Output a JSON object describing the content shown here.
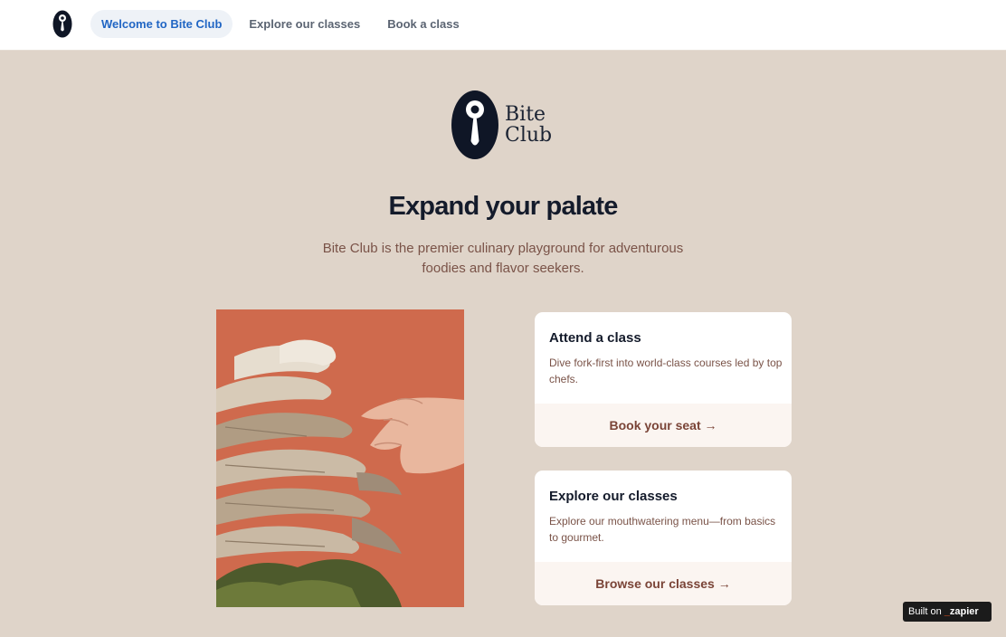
{
  "nav": {
    "logo_icon": "bite-club-spoon-icon",
    "links": [
      {
        "label": "Welcome to Bite Club",
        "active": true
      },
      {
        "label": "Explore our classes",
        "active": false
      },
      {
        "label": "Book a class",
        "active": false
      }
    ]
  },
  "hero": {
    "logo_line1": "Bite",
    "logo_line2": "Club",
    "headline": "Expand your palate",
    "subtitle": "Bite Club is the premier culinary playground for adventurous foodies and flavor seekers."
  },
  "cards": [
    {
      "title": "Attend a class",
      "description": "Dive fork-first into world-class courses led by top chefs.",
      "cta": "Book your seat →"
    },
    {
      "title": "Explore our classes",
      "description": "Explore our mouthwatering menu—from basics to gourmet.",
      "cta": "Browse our classes →"
    }
  ],
  "badge": {
    "prefix": "Built on",
    "brand": "zapier"
  },
  "colors": {
    "page_bg": "#dfd4c9",
    "accent_link": "#2166c4",
    "brown_text": "#7a5348",
    "photo_bg": "#cf6a4d"
  }
}
